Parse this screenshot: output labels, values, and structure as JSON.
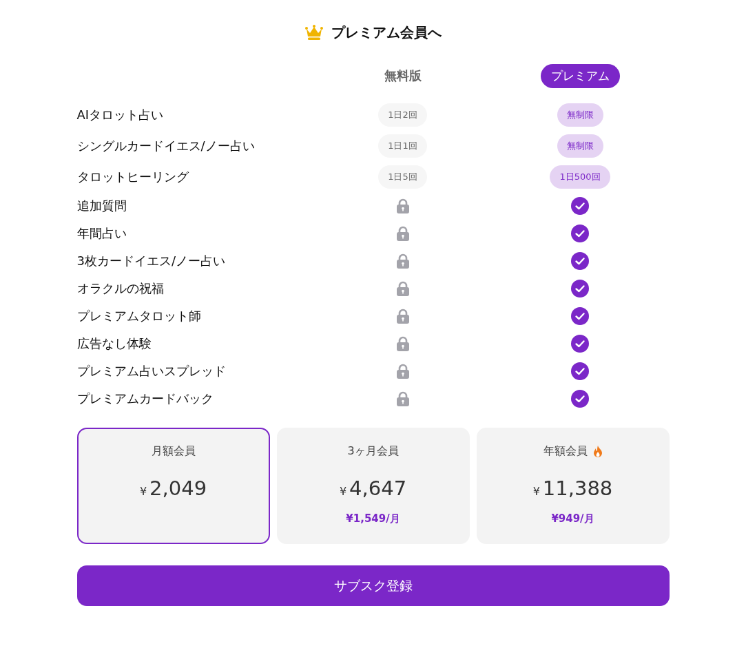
{
  "title": "プレミアム会員へ",
  "columns": [
    {
      "label": "無料版",
      "kind": "plain"
    },
    {
      "label": "プレミアム",
      "kind": "pill"
    }
  ],
  "features": [
    {
      "name": "AIタロット占い",
      "free": {
        "kind": "text",
        "text": "1日2回"
      },
      "premium": {
        "kind": "text",
        "text": "無制限"
      }
    },
    {
      "name": "シングルカードイエス/ノー占い",
      "free": {
        "kind": "text",
        "text": "1日1回"
      },
      "premium": {
        "kind": "text",
        "text": "無制限"
      }
    },
    {
      "name": "タロットヒーリング",
      "free": {
        "kind": "text",
        "text": "1日5回"
      },
      "premium": {
        "kind": "text",
        "text": "1日500回"
      }
    },
    {
      "name": "追加質問",
      "free": {
        "kind": "locked"
      },
      "premium": {
        "kind": "included"
      }
    },
    {
      "name": "年間占い",
      "free": {
        "kind": "locked"
      },
      "premium": {
        "kind": "included"
      }
    },
    {
      "name": "3枚カードイエス/ノー占い",
      "free": {
        "kind": "locked"
      },
      "premium": {
        "kind": "included"
      }
    },
    {
      "name": "オラクルの祝福",
      "free": {
        "kind": "locked"
      },
      "premium": {
        "kind": "included"
      }
    },
    {
      "name": "プレミアムタロット師",
      "free": {
        "kind": "locked"
      },
      "premium": {
        "kind": "included"
      }
    },
    {
      "name": "広告なし体験",
      "free": {
        "kind": "locked"
      },
      "premium": {
        "kind": "included"
      }
    },
    {
      "name": "プレミアム占いスプレッド",
      "free": {
        "kind": "locked"
      },
      "premium": {
        "kind": "included"
      }
    },
    {
      "name": "プレミアムカードバック",
      "free": {
        "kind": "locked"
      },
      "premium": {
        "kind": "included"
      }
    }
  ],
  "plans": [
    {
      "name": "月額会員",
      "currency": "¥",
      "price": "2,049",
      "selected": true,
      "hot": false
    },
    {
      "name": "3ヶ月会員",
      "currency": "¥",
      "price": "4,647",
      "per_month": "¥1,549/月",
      "selected": false,
      "hot": false
    },
    {
      "name": "年額会員",
      "currency": "¥",
      "price": "11,388",
      "per_month": "¥949/月",
      "selected": false,
      "hot": true
    }
  ],
  "subscribe_button": "サブスク登録"
}
